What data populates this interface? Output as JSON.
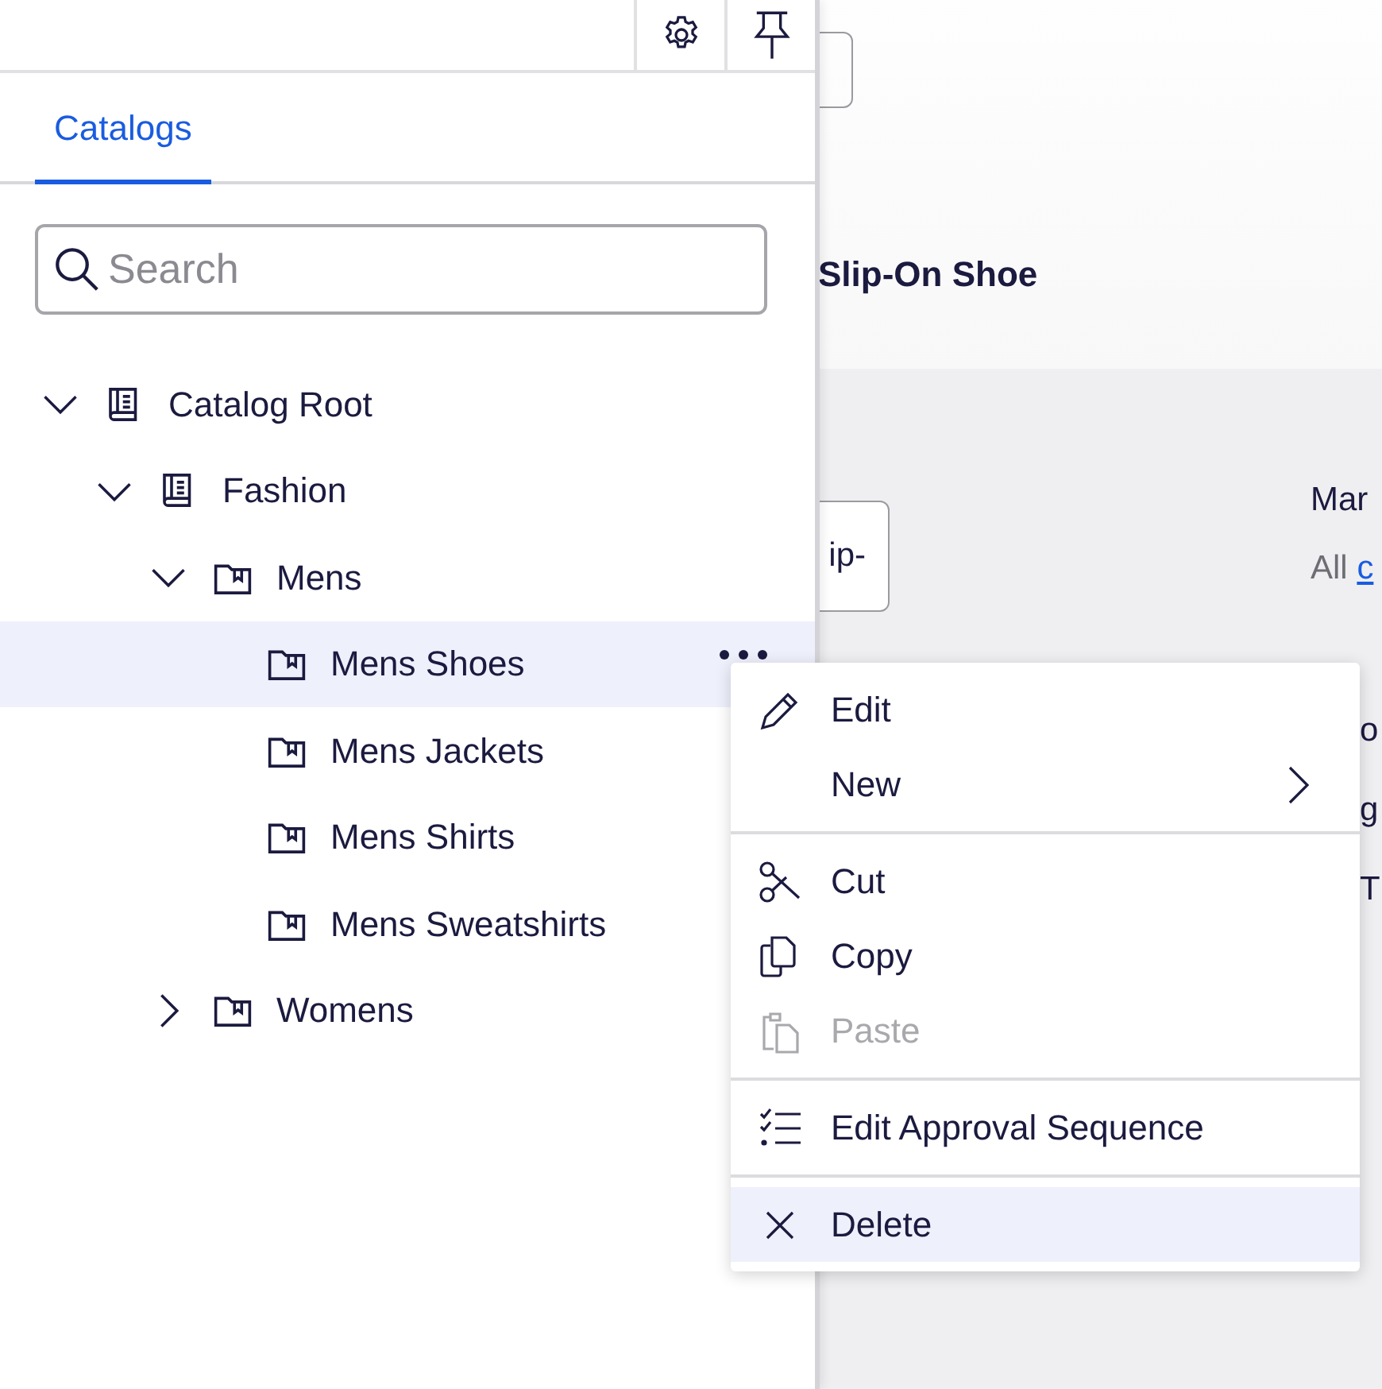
{
  "background": {
    "product_title": "Slip-On Shoe",
    "field_value": "ip-",
    "label": "Mar",
    "hint": {
      "text": "All",
      "link": "c"
    },
    "behind_menu": [
      "o",
      "g",
      "T"
    ]
  },
  "panel": {
    "tabs": [
      {
        "label": "Catalogs",
        "selected": true
      }
    ],
    "search": {
      "placeholder": "Search"
    },
    "tree": [
      {
        "label": "Catalog Root",
        "kind": "catalog",
        "expanded": true,
        "selected": false,
        "children": [
          {
            "label": "Fashion",
            "kind": "catalog",
            "expanded": true,
            "selected": false,
            "children": [
              {
                "label": "Mens",
                "kind": "category",
                "expanded": true,
                "selected": false,
                "children": [
                  {
                    "label": "Mens Shoes",
                    "kind": "category",
                    "selected": true
                  },
                  {
                    "label": "Mens Jackets",
                    "kind": "category",
                    "selected": false
                  },
                  {
                    "label": "Mens Shirts",
                    "kind": "category",
                    "selected": false
                  },
                  {
                    "label": "Mens Sweatshirts",
                    "kind": "category",
                    "selected": false
                  }
                ]
              },
              {
                "label": "Womens",
                "kind": "category",
                "expanded": false,
                "selected": false
              }
            ]
          }
        ]
      }
    ]
  },
  "context_menu": {
    "groups": [
      [
        {
          "label": "Edit",
          "submenu": false,
          "disabled": false,
          "selected": false
        },
        {
          "label": "New",
          "submenu": true,
          "disabled": false,
          "selected": false
        }
      ],
      [
        {
          "label": "Cut",
          "submenu": false,
          "disabled": false,
          "selected": false
        },
        {
          "label": "Copy",
          "submenu": false,
          "disabled": false,
          "selected": false
        },
        {
          "label": "Paste",
          "submenu": false,
          "disabled": true,
          "selected": false
        }
      ],
      [
        {
          "label": "Edit Approval Sequence",
          "submenu": false,
          "disabled": false,
          "selected": false
        }
      ],
      [
        {
          "label": "Delete",
          "submenu": false,
          "disabled": false,
          "selected": true
        }
      ]
    ]
  }
}
